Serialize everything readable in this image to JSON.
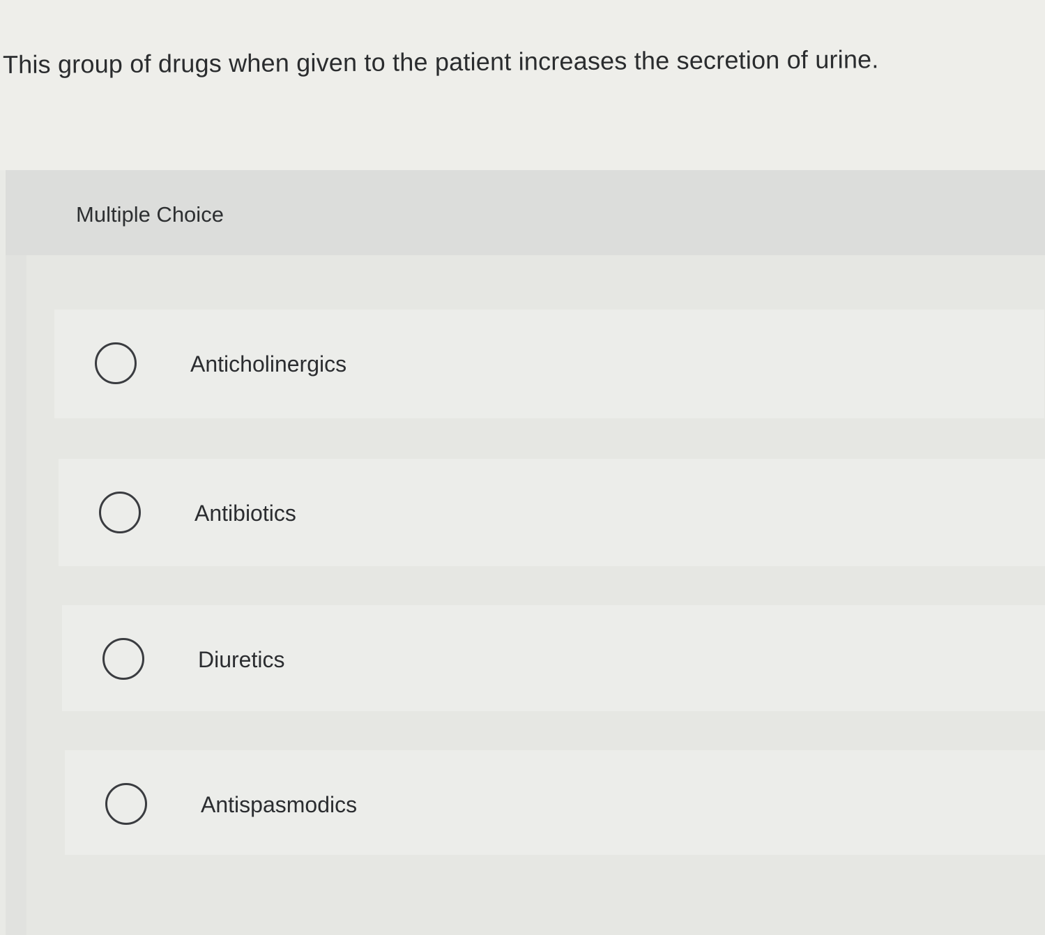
{
  "question": {
    "text": "This group of drugs when given to the patient increases the secretion of urine."
  },
  "panel": {
    "label": "Multiple Choice"
  },
  "options": [
    {
      "label": "Anticholinergics",
      "selected": false
    },
    {
      "label": "Antibiotics",
      "selected": false
    },
    {
      "label": "Diuretics",
      "selected": false
    },
    {
      "label": "Antispasmodics",
      "selected": false
    }
  ],
  "colors": {
    "background": "#e9eae6",
    "text": "#2b2d2f",
    "radio_border": "#3a3c40"
  }
}
